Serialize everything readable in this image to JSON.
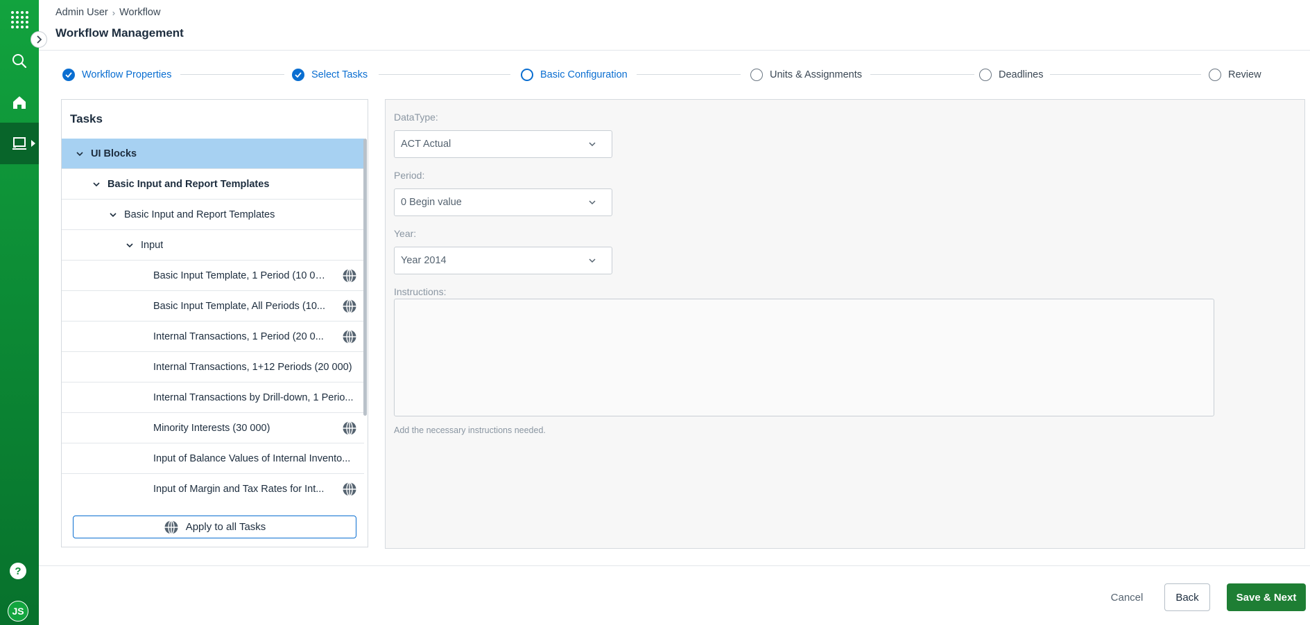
{
  "rail": {
    "icons": [
      "apps-grid-icon",
      "search-icon",
      "home-icon",
      "laptop-icon",
      "help-icon"
    ],
    "avatar_initials": "JS",
    "help_label": "?",
    "accent": "#0c8a35"
  },
  "header": {
    "breadcrumb": [
      "Admin User",
      "Workflow"
    ],
    "title": "Workflow Management"
  },
  "stepper": {
    "steps": [
      {
        "label": "Workflow Properties",
        "state": "done"
      },
      {
        "label": "Select Tasks",
        "state": "done"
      },
      {
        "label": "Basic Configuration",
        "state": "current"
      },
      {
        "label": "Units & Assignments",
        "state": "pending"
      },
      {
        "label": "Deadlines",
        "state": "pending"
      },
      {
        "label": "Review",
        "state": "pending"
      }
    ]
  },
  "tasks": {
    "title": "Tasks",
    "tree": [
      {
        "label": "UI Blocks",
        "level": 0,
        "expanded": true,
        "selected": true,
        "bold": true
      },
      {
        "label": "Basic Input and Report Templates",
        "level": 1,
        "expanded": true,
        "bold": true
      },
      {
        "label": "Basic Input and Report Templates",
        "level": 2,
        "expanded": true
      },
      {
        "label": "Input",
        "level": 3,
        "expanded": true
      },
      {
        "label": "Basic Input Template, 1 Period (10 00...",
        "level": 4,
        "globe": true
      },
      {
        "label": "Basic Input Template, All Periods (10...",
        "level": 4,
        "globe": true
      },
      {
        "label": "Internal Transactions, 1 Period (20 0...",
        "level": 4,
        "globe": true
      },
      {
        "label": "Internal Transactions, 1+12 Periods (20 000)",
        "level": 4
      },
      {
        "label": "Internal Transactions by Drill-down, 1 Perio...",
        "level": 4
      },
      {
        "label": "Minority Interests (30 000)",
        "level": 4,
        "globe": true
      },
      {
        "label": "Input of Balance Values of Internal Invento...",
        "level": 4
      },
      {
        "label": "Input of Margin and Tax Rates for Int...",
        "level": 4,
        "globe": true
      }
    ],
    "apply_button": "Apply to all Tasks"
  },
  "config": {
    "datatype_label": "DataType:",
    "datatype_value": "ACT Actual",
    "period_label": "Period:",
    "period_value": "0 Begin value",
    "year_label": "Year:",
    "year_value": "Year 2014",
    "instructions_label": "Instructions:",
    "instructions_value": "",
    "instructions_hint": "Add the necessary instructions needed."
  },
  "footer": {
    "cancel": "Cancel",
    "back": "Back",
    "save_next": "Save & Next",
    "primary_color": "#1e7e34"
  }
}
